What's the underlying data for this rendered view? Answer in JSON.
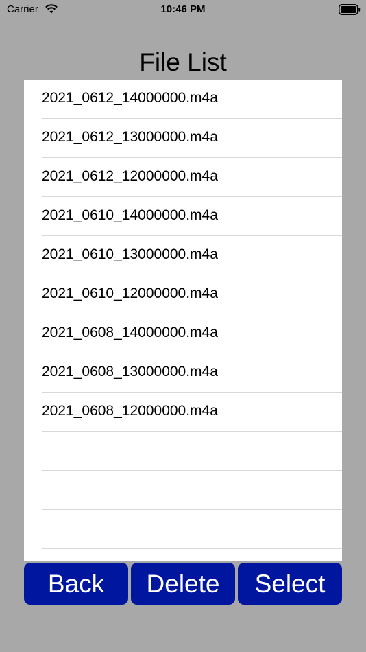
{
  "status_bar": {
    "carrier": "Carrier",
    "time": "10:46 PM",
    "icons": [
      "wifi-icon",
      "battery-icon"
    ]
  },
  "page": {
    "title": "File List"
  },
  "file_list": {
    "items": [
      "2021_0612_14000000.m4a",
      "2021_0612_13000000.m4a",
      "2021_0612_12000000.m4a",
      "2021_0610_14000000.m4a",
      "2021_0610_13000000.m4a",
      "2021_0610_12000000.m4a",
      "2021_0608_14000000.m4a",
      "2021_0608_13000000.m4a",
      "2021_0608_12000000.m4a",
      "",
      "",
      "",
      ""
    ]
  },
  "toolbar": {
    "back_label": "Back",
    "delete_label": "Delete",
    "select_label": "Select"
  },
  "colors": {
    "background": "#a8a8a8",
    "button": "#00169e",
    "button_text": "#ffffff",
    "list_background": "#ffffff",
    "divider": "#d9d9d9"
  }
}
